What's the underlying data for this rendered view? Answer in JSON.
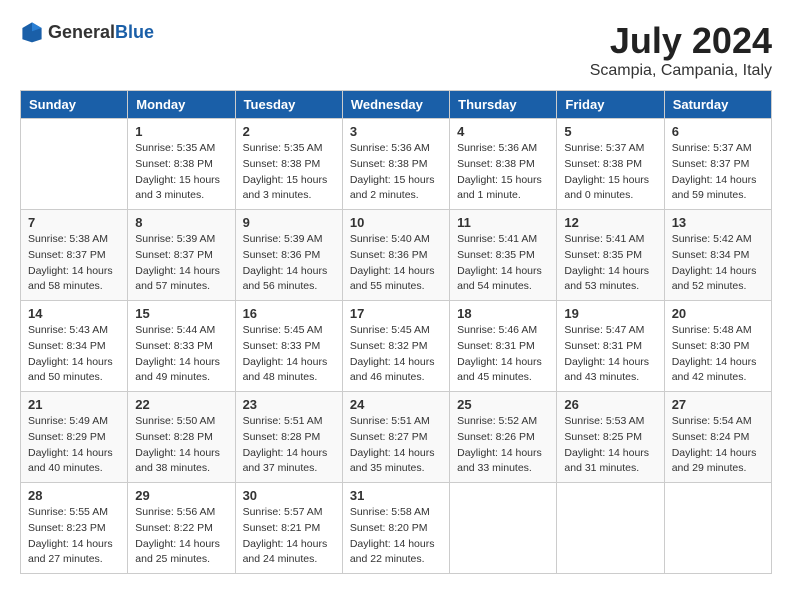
{
  "logo": {
    "general": "General",
    "blue": "Blue"
  },
  "title": "July 2024",
  "location": "Scampia, Campania, Italy",
  "days_header": [
    "Sunday",
    "Monday",
    "Tuesday",
    "Wednesday",
    "Thursday",
    "Friday",
    "Saturday"
  ],
  "weeks": [
    [
      {
        "day": "",
        "sunrise": "",
        "sunset": "",
        "daylight": ""
      },
      {
        "day": "1",
        "sunrise": "Sunrise: 5:35 AM",
        "sunset": "Sunset: 8:38 PM",
        "daylight": "Daylight: 15 hours and 3 minutes."
      },
      {
        "day": "2",
        "sunrise": "Sunrise: 5:35 AM",
        "sunset": "Sunset: 8:38 PM",
        "daylight": "Daylight: 15 hours and 3 minutes."
      },
      {
        "day": "3",
        "sunrise": "Sunrise: 5:36 AM",
        "sunset": "Sunset: 8:38 PM",
        "daylight": "Daylight: 15 hours and 2 minutes."
      },
      {
        "day": "4",
        "sunrise": "Sunrise: 5:36 AM",
        "sunset": "Sunset: 8:38 PM",
        "daylight": "Daylight: 15 hours and 1 minute."
      },
      {
        "day": "5",
        "sunrise": "Sunrise: 5:37 AM",
        "sunset": "Sunset: 8:38 PM",
        "daylight": "Daylight: 15 hours and 0 minutes."
      },
      {
        "day": "6",
        "sunrise": "Sunrise: 5:37 AM",
        "sunset": "Sunset: 8:37 PM",
        "daylight": "Daylight: 14 hours and 59 minutes."
      }
    ],
    [
      {
        "day": "7",
        "sunrise": "Sunrise: 5:38 AM",
        "sunset": "Sunset: 8:37 PM",
        "daylight": "Daylight: 14 hours and 58 minutes."
      },
      {
        "day": "8",
        "sunrise": "Sunrise: 5:39 AM",
        "sunset": "Sunset: 8:37 PM",
        "daylight": "Daylight: 14 hours and 57 minutes."
      },
      {
        "day": "9",
        "sunrise": "Sunrise: 5:39 AM",
        "sunset": "Sunset: 8:36 PM",
        "daylight": "Daylight: 14 hours and 56 minutes."
      },
      {
        "day": "10",
        "sunrise": "Sunrise: 5:40 AM",
        "sunset": "Sunset: 8:36 PM",
        "daylight": "Daylight: 14 hours and 55 minutes."
      },
      {
        "day": "11",
        "sunrise": "Sunrise: 5:41 AM",
        "sunset": "Sunset: 8:35 PM",
        "daylight": "Daylight: 14 hours and 54 minutes."
      },
      {
        "day": "12",
        "sunrise": "Sunrise: 5:41 AM",
        "sunset": "Sunset: 8:35 PM",
        "daylight": "Daylight: 14 hours and 53 minutes."
      },
      {
        "day": "13",
        "sunrise": "Sunrise: 5:42 AM",
        "sunset": "Sunset: 8:34 PM",
        "daylight": "Daylight: 14 hours and 52 minutes."
      }
    ],
    [
      {
        "day": "14",
        "sunrise": "Sunrise: 5:43 AM",
        "sunset": "Sunset: 8:34 PM",
        "daylight": "Daylight: 14 hours and 50 minutes."
      },
      {
        "day": "15",
        "sunrise": "Sunrise: 5:44 AM",
        "sunset": "Sunset: 8:33 PM",
        "daylight": "Daylight: 14 hours and 49 minutes."
      },
      {
        "day": "16",
        "sunrise": "Sunrise: 5:45 AM",
        "sunset": "Sunset: 8:33 PM",
        "daylight": "Daylight: 14 hours and 48 minutes."
      },
      {
        "day": "17",
        "sunrise": "Sunrise: 5:45 AM",
        "sunset": "Sunset: 8:32 PM",
        "daylight": "Daylight: 14 hours and 46 minutes."
      },
      {
        "day": "18",
        "sunrise": "Sunrise: 5:46 AM",
        "sunset": "Sunset: 8:31 PM",
        "daylight": "Daylight: 14 hours and 45 minutes."
      },
      {
        "day": "19",
        "sunrise": "Sunrise: 5:47 AM",
        "sunset": "Sunset: 8:31 PM",
        "daylight": "Daylight: 14 hours and 43 minutes."
      },
      {
        "day": "20",
        "sunrise": "Sunrise: 5:48 AM",
        "sunset": "Sunset: 8:30 PM",
        "daylight": "Daylight: 14 hours and 42 minutes."
      }
    ],
    [
      {
        "day": "21",
        "sunrise": "Sunrise: 5:49 AM",
        "sunset": "Sunset: 8:29 PM",
        "daylight": "Daylight: 14 hours and 40 minutes."
      },
      {
        "day": "22",
        "sunrise": "Sunrise: 5:50 AM",
        "sunset": "Sunset: 8:28 PM",
        "daylight": "Daylight: 14 hours and 38 minutes."
      },
      {
        "day": "23",
        "sunrise": "Sunrise: 5:51 AM",
        "sunset": "Sunset: 8:28 PM",
        "daylight": "Daylight: 14 hours and 37 minutes."
      },
      {
        "day": "24",
        "sunrise": "Sunrise: 5:51 AM",
        "sunset": "Sunset: 8:27 PM",
        "daylight": "Daylight: 14 hours and 35 minutes."
      },
      {
        "day": "25",
        "sunrise": "Sunrise: 5:52 AM",
        "sunset": "Sunset: 8:26 PM",
        "daylight": "Daylight: 14 hours and 33 minutes."
      },
      {
        "day": "26",
        "sunrise": "Sunrise: 5:53 AM",
        "sunset": "Sunset: 8:25 PM",
        "daylight": "Daylight: 14 hours and 31 minutes."
      },
      {
        "day": "27",
        "sunrise": "Sunrise: 5:54 AM",
        "sunset": "Sunset: 8:24 PM",
        "daylight": "Daylight: 14 hours and 29 minutes."
      }
    ],
    [
      {
        "day": "28",
        "sunrise": "Sunrise: 5:55 AM",
        "sunset": "Sunset: 8:23 PM",
        "daylight": "Daylight: 14 hours and 27 minutes."
      },
      {
        "day": "29",
        "sunrise": "Sunrise: 5:56 AM",
        "sunset": "Sunset: 8:22 PM",
        "daylight": "Daylight: 14 hours and 25 minutes."
      },
      {
        "day": "30",
        "sunrise": "Sunrise: 5:57 AM",
        "sunset": "Sunset: 8:21 PM",
        "daylight": "Daylight: 14 hours and 24 minutes."
      },
      {
        "day": "31",
        "sunrise": "Sunrise: 5:58 AM",
        "sunset": "Sunset: 8:20 PM",
        "daylight": "Daylight: 14 hours and 22 minutes."
      },
      {
        "day": "",
        "sunrise": "",
        "sunset": "",
        "daylight": ""
      },
      {
        "day": "",
        "sunrise": "",
        "sunset": "",
        "daylight": ""
      },
      {
        "day": "",
        "sunrise": "",
        "sunset": "",
        "daylight": ""
      }
    ]
  ]
}
